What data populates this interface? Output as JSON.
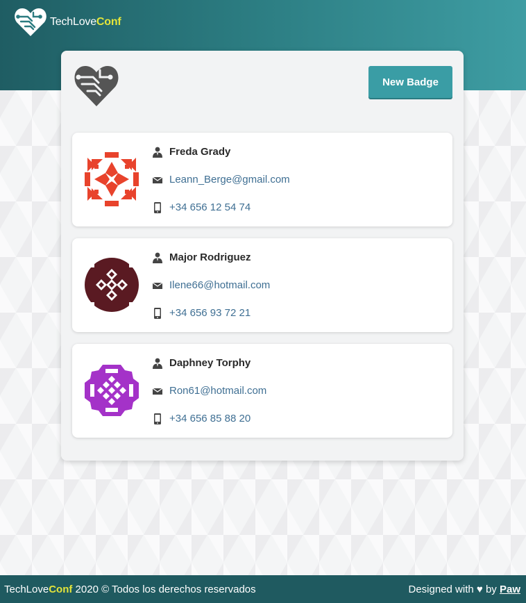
{
  "brand": {
    "name_main": "TechLove",
    "name_accent": "Conf"
  },
  "actions": {
    "new_badge_label": "New Badge"
  },
  "badges": [
    {
      "name": "Freda Grady",
      "email": "Leann_Berge@gmail.com",
      "phone": "+34 656 12 54 74",
      "avatar_color": "#e8432c"
    },
    {
      "name": "Major Rodriguez",
      "email": "Ilene66@hotmail.com",
      "phone": "+34 656 93 72 21",
      "avatar_color": "#5a1a22"
    },
    {
      "name": "Daphney Torphy",
      "email": "Ron61@hotmail.com",
      "phone": "+34 656 85 88 20",
      "avatar_color": "#a432c8"
    }
  ],
  "footer": {
    "brand_main": "TechLove",
    "brand_accent": "Conf",
    "copyright_text": " 2020 © Todos los derechos reservados",
    "designed_prefix": "Designed with",
    "designed_by": "by",
    "author": "Paw"
  },
  "colors": {
    "header_start": "#1f5d63",
    "header_end": "#3e9da3",
    "accent_button": "#3a9da5",
    "brand_yellow": "#e3e43a",
    "link": "#3f6f93"
  },
  "icons": {
    "brand_logo": "heart-circuit-icon",
    "name": "user-icon",
    "email": "envelope-icon",
    "phone": "mobile-phone-icon",
    "love": "heart-icon"
  }
}
